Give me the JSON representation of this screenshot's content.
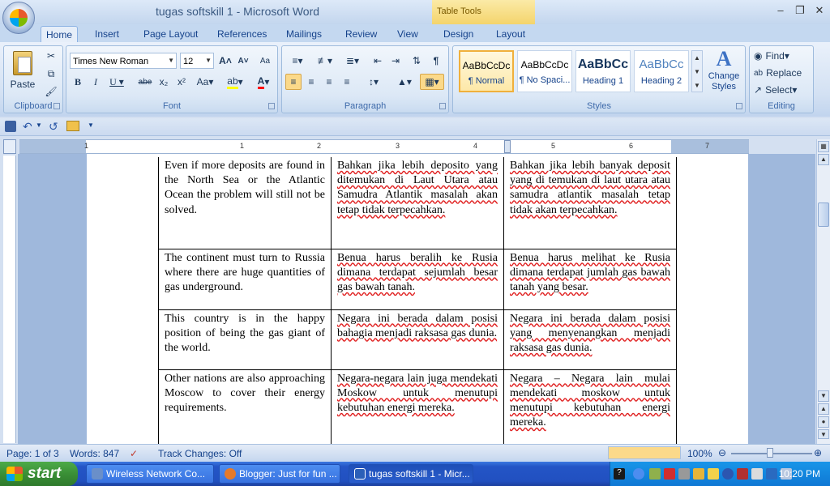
{
  "window": {
    "title": "tugas softskill 1 - Microsoft Word",
    "contextual_tab_group": "Table Tools"
  },
  "tabs": [
    "Home",
    "Insert",
    "Page Layout",
    "References",
    "Mailings",
    "Review",
    "View",
    "Design",
    "Layout"
  ],
  "active_tab": "Home",
  "clipboard": {
    "paste_label": "Paste",
    "group_label": "Clipboard"
  },
  "font": {
    "name": "Times New Roman",
    "size": "12",
    "group_label": "Font"
  },
  "paragraph": {
    "group_label": "Paragraph"
  },
  "styles": {
    "group_label": "Styles",
    "tiles": [
      {
        "preview": "AaBbCcDc",
        "label": "¶ Normal"
      },
      {
        "preview": "AaBbCcDc",
        "label": "¶ No Spaci..."
      },
      {
        "preview": "AaBbCc",
        "label": "Heading 1"
      },
      {
        "preview": "AaBbCc",
        "label": "Heading 2"
      }
    ],
    "change_styles": "Change Styles"
  },
  "editing": {
    "find": "Find",
    "replace": "Replace",
    "select": "Select",
    "group_label": "Editing"
  },
  "ruler_numbers": [
    "1",
    "1",
    "2",
    "3",
    "4",
    "5",
    "6",
    "7"
  ],
  "table_rows": [
    [
      "Even if more deposits are found in the North Sea or the Atlantic Ocean the problem will still not be solved.",
      "Bahkan jika lebih deposito yang ditemukan di Laut Utara atau Samudra Atlantik masalah akan tetap tidak terpecahkan.",
      "Bahkan jika lebih banyak deposit yang di temukan di laut utara atau samudra atlantik masalah tetap tidak akan terpecahkan."
    ],
    [
      "The continent must turn to Russia where there are huge quantities of gas underground.",
      "Benua harus beralih ke Rusia dimana terdapat sejumlah besar gas bawah tanah.",
      "Benua harus melihat ke Rusia dimana terdapat jumlah gas bawah tanah yang besar."
    ],
    [
      "This country is in the happy position of being the gas giant of the world.",
      "Negara ini berada dalam posisi bahagia menjadi raksasa gas dunia.",
      "Negara ini berada dalam posisi yang menyenangkan menjadi raksasa gas dunia."
    ],
    [
      "Other nations are also approaching Moscow to cover their energy requirements.",
      "Negara-negara lain juga mendekati Moskow untuk menutupi kebutuhan energi mereka.",
      "Negara – Negara lain mulai mendekati moskow untuk menutupi kebutuhan energi mereka."
    ]
  ],
  "status": {
    "page": "Page: 1 of 3",
    "words": "Words: 847",
    "track_changes": "Track Changes: Off",
    "zoom": "100%"
  },
  "taskbar": {
    "start": "start",
    "tasks": [
      "Wireless Network Co...",
      "Blogger: Just for fun ...",
      "tugas softskill 1 - Micr..."
    ],
    "clock": "10:20 PM"
  }
}
